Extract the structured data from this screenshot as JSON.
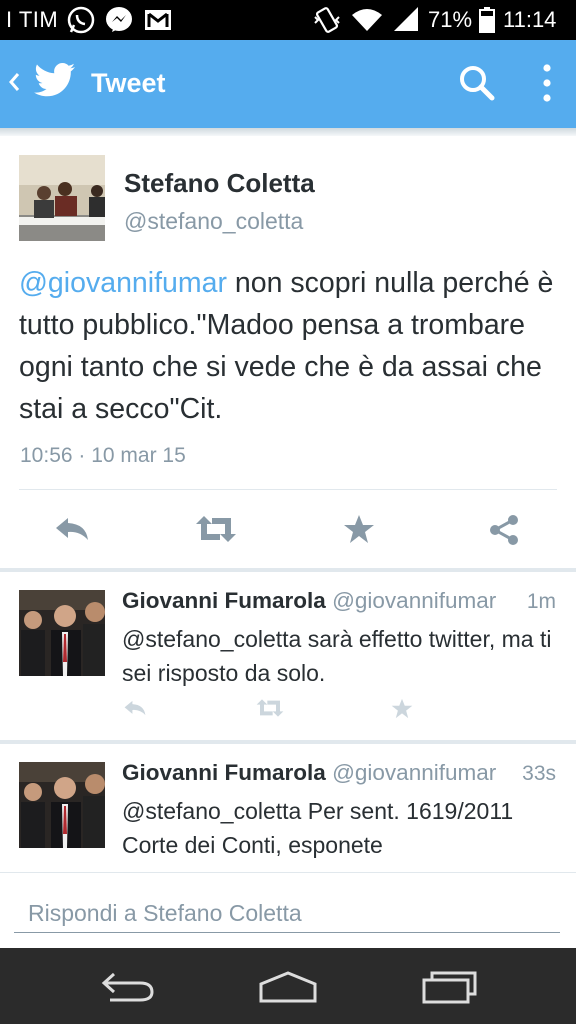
{
  "status_bar": {
    "carrier": "I TIM",
    "battery": "71%",
    "time": "11:14",
    "icons": [
      "whatsapp-icon",
      "messenger-icon",
      "gmail-icon",
      "vibrate-icon",
      "wifi-icon",
      "signal-icon",
      "battery-icon"
    ]
  },
  "action_bar": {
    "title": "Tweet",
    "icons": [
      "back-chevron-icon",
      "twitter-bird-icon",
      "search-icon",
      "overflow-menu-icon"
    ]
  },
  "main_tweet": {
    "name": "Stefano Coletta",
    "handle": "@stefano_coletta",
    "mention": "@giovannifumar",
    "text_rest": " non scopri nulla perché è tutto  pubblico.\"Madoo pensa a trombare ogni tanto che si vede che è da assai che stai a secco\"Cit.",
    "timestamp": "10:56 · 10 mar 15",
    "actions": [
      "reply-icon",
      "retweet-icon",
      "favorite-icon",
      "share-icon"
    ]
  },
  "replies": [
    {
      "name": "Giovanni Fumarola",
      "handle": "@giovannifumar",
      "time": "1m",
      "text": "@stefano_coletta sarà effetto twitter, ma ti sei risposto da solo."
    },
    {
      "name": "Giovanni Fumarola",
      "handle": "@giovannifumar",
      "time": "33s",
      "text": "@stefano_coletta Per sent. 1619/2011 Corte dei Conti, esponete"
    }
  ],
  "compose": {
    "placeholder": "Rispondi a Stefano Coletta"
  },
  "nav_bar": {
    "icons": [
      "back-nav-icon",
      "home-nav-icon",
      "recents-nav-icon"
    ]
  },
  "colors": {
    "accent": "#55acee",
    "text": "#292f33",
    "muted": "#8899a6",
    "nav": "#2b2b2b"
  }
}
